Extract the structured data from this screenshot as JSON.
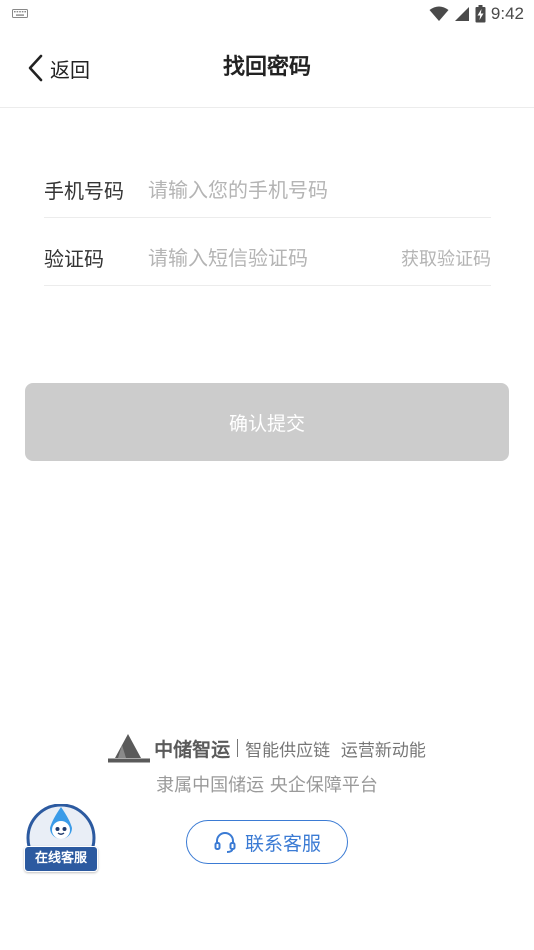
{
  "status_bar": {
    "time": "9:42",
    "icons": [
      "keyboard-icon",
      "wifi-icon",
      "cellular-signal-icon",
      "battery-charging-icon"
    ]
  },
  "header": {
    "back_label": "返回",
    "title": "找回密码"
  },
  "form": {
    "phone": {
      "label": "手机号码",
      "value": "",
      "placeholder": "请输入您的手机号码"
    },
    "code": {
      "label": "验证码",
      "value": "",
      "placeholder": "请输入短信验证码",
      "get_code_label": "获取验证码"
    }
  },
  "submit": {
    "label": "确认提交"
  },
  "brand": {
    "name": "中储智运",
    "slogan": "智能供应链  运营新动能",
    "subtitle": "隶属中国储运 央企保障平台"
  },
  "contact": {
    "label": "联系客服"
  },
  "online_service": {
    "label": "在线客服"
  },
  "colors": {
    "accent": "#3b7bd4",
    "button_disabled": "#cccccc",
    "badge": "#2c5aa0",
    "placeholder": "#b4b4b4"
  }
}
